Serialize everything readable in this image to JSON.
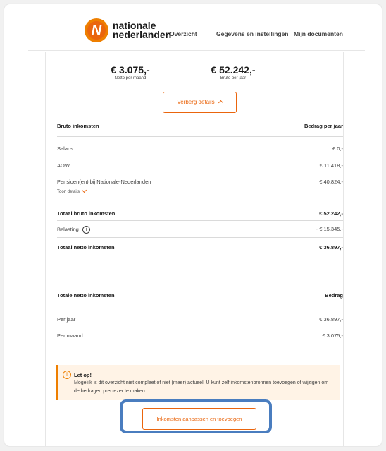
{
  "header": {
    "logo_mark": "N",
    "brand_line1": "nationale",
    "brand_line2": "nederlanden",
    "nav": [
      "Overzicht",
      "Gegevens en instellingen",
      "Mijn documenten"
    ]
  },
  "summary": {
    "netto_amount": "€ 3.075,-",
    "netto_label": "Netto per maand",
    "bruto_amount": "€ 52.242,-",
    "bruto_label": "Bruto per jaar"
  },
  "hide_details_label": "Verberg details",
  "bruto_table": {
    "header_left": "Bruto inkomsten",
    "header_right": "Bedrag per jaar",
    "rows": [
      {
        "label": "Salaris",
        "value": "€ 0,-"
      },
      {
        "label": "AOW",
        "value": "€ 11.418,-"
      },
      {
        "label": "Pensioen(en) bij Nationale-Nederlanden",
        "value": "€ 40.824,-"
      }
    ],
    "toggle_label": "Toon details",
    "totaal_bruto": {
      "label": "Totaal bruto inkomsten",
      "value": "€ 52.242,-"
    },
    "belasting": {
      "label": "Belasting",
      "value": "- € 15.345,-"
    },
    "totaal_netto": {
      "label": "Totaal netto inkomsten",
      "value": "€ 36.897,-"
    }
  },
  "netto_table": {
    "header_left": "Totale netto inkomsten",
    "header_right": "Bedrag",
    "rows": [
      {
        "label": "Per jaar",
        "value": "€ 36.897,-"
      },
      {
        "label": "Per maand",
        "value": "€ 3.075,-"
      }
    ]
  },
  "alert": {
    "icon": "i",
    "title": "Let op!",
    "body": "Mogelijk is dit overzicht niet compleet of niet (meer) actueel. U kunt zelf inkomstenbronnen toevoegen of wijzigen om de bedragen preciezer te maken."
  },
  "adjust_button_label": "Inkomsten aanpassen en toevoegen",
  "colors": {
    "brand_orange": "#ea650d",
    "alert_bg": "#fff3e6",
    "highlight_blue": "#4a7dbf"
  }
}
